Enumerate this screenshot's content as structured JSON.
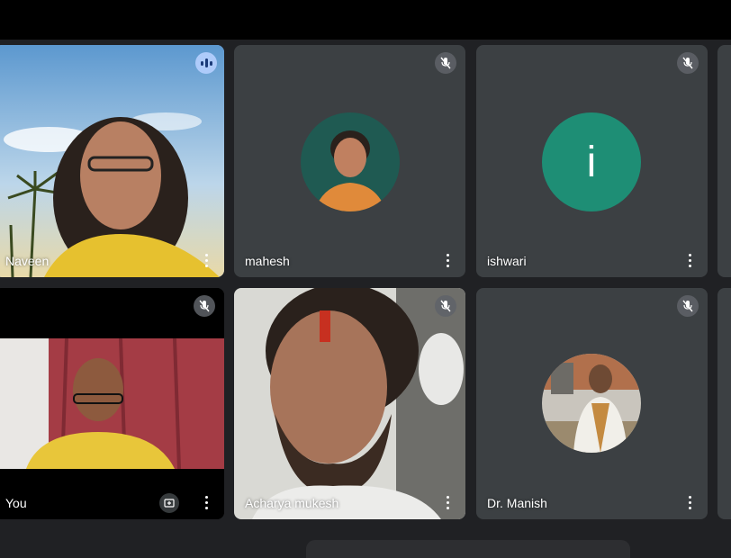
{
  "participants": [
    {
      "name": "Naveen",
      "state": "speaking",
      "has_video": true
    },
    {
      "name": "mahesh",
      "state": "muted",
      "has_video": false,
      "avatar": "photo"
    },
    {
      "name": "ishwari",
      "state": "muted",
      "has_video": false,
      "avatar_letter": "i",
      "avatar_color": "#1e8e75"
    },
    {
      "name": "You",
      "state": "muted",
      "has_video": true
    },
    {
      "name": "Acharya mukesh",
      "state": "muted",
      "has_video": true
    },
    {
      "name": "Dr. Manish",
      "state": "muted",
      "has_video": false,
      "avatar": "photo"
    }
  ],
  "colors": {
    "tile": "#3c4043",
    "background": "#202124",
    "speaking_border": "#8ab4f8"
  },
  "icons": {
    "mute": "mic-off-icon",
    "speaking": "audio-level-icon",
    "more": "more-vert-icon",
    "reframe": "reframe-icon"
  }
}
